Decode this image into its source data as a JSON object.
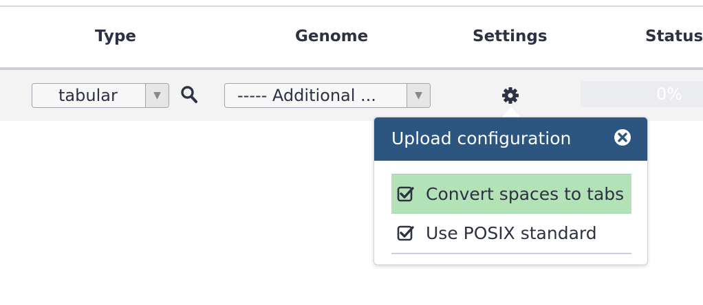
{
  "table": {
    "columns": {
      "type": "Type",
      "genome": "Genome",
      "settings": "Settings",
      "status": "Status"
    }
  },
  "row": {
    "type_select": {
      "value": "tabular"
    },
    "genome_select": {
      "value": "----- Additional ..."
    },
    "progress": {
      "percent_label": "0%",
      "fraction": 0
    }
  },
  "popover": {
    "title": "Upload configuration",
    "options": [
      {
        "label": "Convert spaces to tabs",
        "checked": true,
        "highlighted": true
      },
      {
        "label": "Use POSIX standard",
        "checked": true,
        "highlighted": false
      }
    ]
  },
  "icons": {
    "search": "search-icon",
    "settings": "gear-icon",
    "close": "close-icon",
    "dropdown": "chevron-down-icon",
    "checkbox": "checked-checkbox-icon"
  },
  "colors": {
    "popover_header": "#2c5680",
    "highlight": "#b4e2b7",
    "text": "#2c3143",
    "row_bg": "#f2f3f2"
  }
}
